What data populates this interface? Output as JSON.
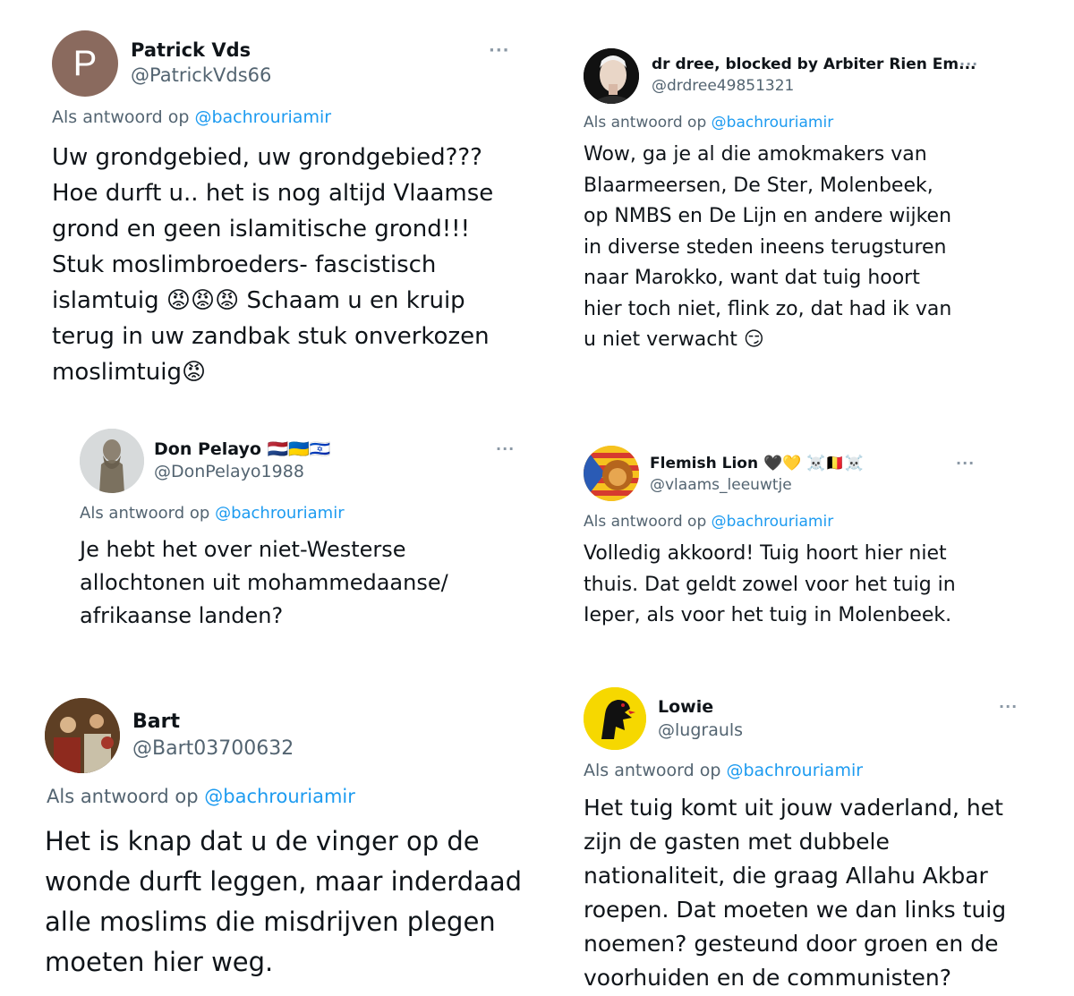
{
  "reply_prefix": "Als antwoord op",
  "tweets": [
    {
      "display_name": "Patrick Vds",
      "handle": "@PatrickVds66",
      "avatar_letter": "P",
      "avatar_color": "#8a6a5e",
      "mention": "@bachrouriamir",
      "lines": [
        "Uw grondgebied, uw grondgebied???",
        "Hoe durft u.. het is nog altijd Vlaamse",
        "grond en geen islamitische grond!!!",
        "Stuk moslimbroeders- fascistisch",
        "islamtuig 😡😡😡 Schaam u en kruip",
        "terug in uw zandbak stuk onverkozen",
        "moslimtuig😡"
      ]
    },
    {
      "display_name": "dr dree, blocked by Arbiter Rien Em...",
      "handle": "@drdree49851321",
      "mention": "@bachrouriamir",
      "lines": [
        "Wow, ga je al die amokmakers van",
        "Blaarmeersen, De Ster, Molenbeek,",
        "op NMBS en De Lijn en andere wijken",
        "in diverse steden  ineens terugsturen",
        "naar Marokko, want dat tuig hoort",
        "hier toch niet, flink zo, dat had ik van",
        "u niet verwacht 😏"
      ]
    },
    {
      "display_name": "Don Pelayo 🇳🇱🇺🇦🇮🇱",
      "handle": "@DonPelayo1988",
      "mention": "@bachrouriamir",
      "lines": [
        "Je hebt het over niet-Westerse",
        "allochtonen uit mohammedaanse/",
        "afrikaanse landen?"
      ]
    },
    {
      "display_name": "Flemish Lion 🖤💛 ☠️🇧🇪☠️",
      "handle": "@vlaams_leeuwtje",
      "mention": "@bachrouriamir",
      "lines": [
        "Volledig akkoord! Tuig hoort hier niet",
        "thuis. Dat geldt zowel voor het tuig in",
        "Ieper, als voor het tuig in Molenbeek."
      ]
    },
    {
      "display_name": "Bart",
      "handle": "@Bart03700632",
      "mention": "@bachrouriamir",
      "lines": [
        "Het is knap dat u de vinger op de",
        "wonde durft leggen, maar inderdaad",
        "alle moslims die misdrijven plegen",
        "moeten hier weg."
      ]
    },
    {
      "display_name": "Lowie",
      "handle": "@lugrauls",
      "mention": "@bachrouriamir",
      "lines": [
        "Het tuig komt uit  jouw vaderland, het",
        "zijn de gasten met dubbele",
        "nationaliteit, die graag Allahu Akbar",
        "roepen. Dat moeten we dan links tuig",
        "noemen? gesteund door groen en de",
        "voorhuiden en de communisten?"
      ]
    }
  ],
  "more_icon": "···",
  "colors": {
    "text": "#0f1419",
    "secondary": "#536471",
    "mention": "#1d9bf0"
  }
}
